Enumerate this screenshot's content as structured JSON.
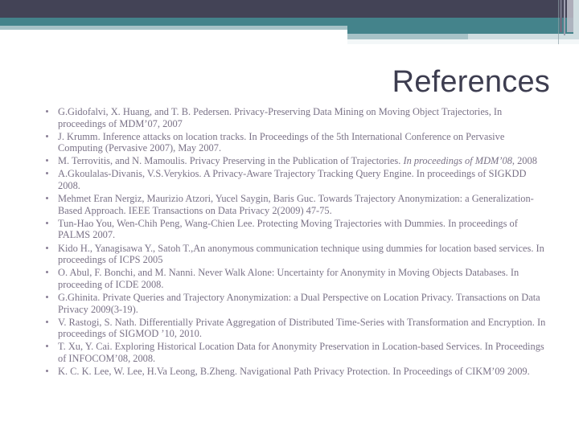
{
  "slide": {
    "title": "References",
    "theme": {
      "dark_band": "#434356",
      "teal_band": "#44838b",
      "pale_band": "#a7c2c7",
      "faint_band": "#cfdde0",
      "title_color": "#3d3d50",
      "body_text_color": "#7a7287",
      "bullet_color": "#8a7f96",
      "background": "#ffffff"
    }
  },
  "references": [
    {
      "id": "ref-1",
      "text": "G.Gidofalvi, X. Huang, and T. B. Pedersen. Privacy-Preserving Data Mining on Moving Object Trajectories, In proceedings of MDM’07, 2007"
    },
    {
      "id": "ref-2",
      "text": "J. Krumm. Inference attacks on location tracks. In Proceedings of the 5th International Conference on Pervasive Computing (Pervasive 2007), May 2007."
    },
    {
      "id": "ref-3",
      "text_before": " M. Terrovitis, and N. Mamoulis. Privacy Preserving in the Publication of Trajectories. ",
      "text_italic": "In proceedings of MDM’08",
      "text_after": ", 2008"
    },
    {
      "id": "ref-4",
      "text": "A.Gkoulalas-Divanis, V.S.Verykios. A Privacy-Aware Trajectory Tracking Query Engine. In proceedings of SIGKDD 2008."
    },
    {
      "id": "ref-5",
      "text": "Mehmet Eran Nergiz, Maurizio Atzori, Yucel Saygin, Baris Guc. Towards Trajectory Anonymization: a Generalization-Based Approach. IEEE Transactions on Data Privacy 2(2009) 47-75."
    },
    {
      "id": "ref-6",
      "text": "Tun-Hao You, Wen-Chih Peng, Wang-Chien Lee. Protecting Moving Trajectories with Dummies. In proceedings of PALMS 2007."
    },
    {
      "id": "ref-7",
      "text": "Kido H., Yanagisawa Y., Satoh T.,An anonymous communication technique using dummies for location based services. In proceedings of ICPS 2005"
    },
    {
      "id": "ref-8",
      "text": "O. Abul, F. Bonchi, and M. Nanni. Never Walk Alone: Uncertainty for Anonymity in Moving Objects Databases. In proceeding of ICDE 2008."
    },
    {
      "id": "ref-9",
      "text": "G.Ghinita. Private Queries and Trajectory Anonymization: a Dual Perspective on Location Privacy. Transactions on Data Privacy 2009(3-19)."
    },
    {
      "id": "ref-10",
      "text": "V. Rastogi, S. Nath. Differentially Private Aggregation of Distributed Time-Series with Transformation and Encryption. In proceedings of SIGMOD ’10, 2010."
    },
    {
      "id": "ref-11",
      "text": "T. Xu, Y. Cai. Exploring Historical Location Data for Anonymity Preservation in Location-based Services. In Proceedings of INFOCOM’08, 2008."
    },
    {
      "id": "ref-12",
      "text": "K. C. K. Lee, W. Lee, H.Va Leong, B.Zheng. Navigational Path Privacy Protection. In Proceedings of CIKM’09 2009."
    }
  ]
}
